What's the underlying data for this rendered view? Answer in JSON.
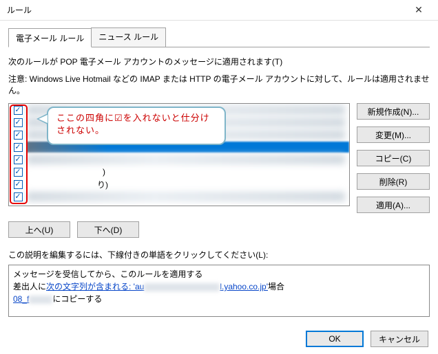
{
  "window": {
    "title": "ルール",
    "close_icon": "✕"
  },
  "tabs": {
    "tab1": "電子メール ルール",
    "tab2": "ニュース ルール"
  },
  "texts": {
    "apply_desc": "次のルールが POP 電子メール アカウントのメッセージに適用されます(T)",
    "warning": "注意: Windows Live Hotmail などの IMAP または HTTP の電子メール アカウントに対して、ルールは適用されません。",
    "explain_label": "この説明を編集するには、下線付きの単語をクリックしてください(L):",
    "explain_line1": "メッセージを受信してから、このルールを適用する",
    "explain_line2_prefix": "差出人に",
    "explain_link1": "次の文字列が含まれる: 'au",
    "explain_link1_suffix": "l.yahoo.co.jp'",
    "explain_line2_suffix": "場合",
    "explain_line3_link": "08_f",
    "explain_line3_suffix": "にコピーする"
  },
  "callout": {
    "text": "ここの四角に☑を入れないと仕分けされない。"
  },
  "rules": [
    {
      "checked": true,
      "label": ""
    },
    {
      "checked": true,
      "label": ""
    },
    {
      "checked": true,
      "label": ""
    },
    {
      "checked": true,
      "label": "",
      "selected": true
    },
    {
      "checked": true,
      "label": ""
    },
    {
      "checked": true,
      "label": " )"
    },
    {
      "checked": true,
      "label": "り)"
    },
    {
      "checked": true,
      "label": ""
    }
  ],
  "buttons": {
    "new": "新規作成(N)...",
    "edit": "変更(M)...",
    "copy": "コピー(C)",
    "delete": "削除(R)",
    "apply": "適用(A)...",
    "up": "上へ(U)",
    "down": "下へ(D)",
    "ok": "OK",
    "cancel": "キャンセル"
  }
}
